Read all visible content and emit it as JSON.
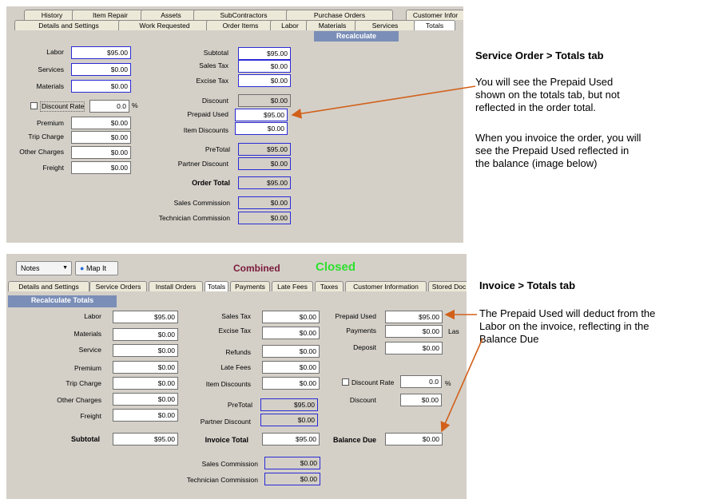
{
  "top": {
    "tabs_back": [
      "History",
      "Item Repair",
      "Assets",
      "SubContractors",
      "Purchase Orders",
      "Customer Infor"
    ],
    "tabs_front": [
      "Details and Settings",
      "Work Requested",
      "Order Items",
      "Labor",
      "Materials",
      "Services",
      "Totals"
    ],
    "recalculate": "Recalculate",
    "left": {
      "labor": {
        "label": "Labor",
        "value": "$95.00"
      },
      "services": {
        "label": "Services",
        "value": "$0.00"
      },
      "materials": {
        "label": "Materials",
        "value": "$0.00"
      },
      "discount_rate": {
        "label": "Discount Rate",
        "value": "0.0",
        "unit": "%"
      },
      "premium": {
        "label": "Premium",
        "value": "$0.00"
      },
      "trip_charge": {
        "label": "Trip Charge",
        "value": "$0.00"
      },
      "other_charges": {
        "label": "Other Charges",
        "value": "$0.00"
      },
      "freight": {
        "label": "Freight",
        "value": "$0.00"
      }
    },
    "right": {
      "subtotal": {
        "label": "Subtotal",
        "value": "$95.00"
      },
      "sales_tax": {
        "label": "Sales Tax",
        "value": "$0.00"
      },
      "excise_tax": {
        "label": "Excise Tax",
        "value": "$0.00"
      },
      "discount": {
        "label": "Discount",
        "value": "$0.00"
      },
      "prepaid_used": {
        "label": "Prepaid Used",
        "value": "$95.00"
      },
      "item_discounts": {
        "label": "Item Discounts",
        "value": "$0.00"
      },
      "pretotal": {
        "label": "PreTotal",
        "value": "$95.00"
      },
      "partner_discount": {
        "label": "Partner Discount",
        "value": "$0.00"
      },
      "order_total": {
        "label": "Order Total",
        "value": "$95.00"
      },
      "sales_commission": {
        "label": "Sales Commission",
        "value": "$0.00"
      },
      "technician_commission": {
        "label": "Technician Commission",
        "value": "$0.00"
      }
    }
  },
  "bottom": {
    "notes_button": "Notes",
    "map_button": "Map It",
    "status_combined": "Combined",
    "status_closed": "Closed",
    "tabs": [
      "Details and Settings",
      "Service Orders",
      "Install Orders",
      "Totals",
      "Payments",
      "Late Fees",
      "Taxes",
      "Customer Information",
      "Stored Doc"
    ],
    "recalculate": "Recalculate Totals",
    "col1": {
      "labor": {
        "label": "Labor",
        "value": "$95.00"
      },
      "materials": {
        "label": "Materials",
        "value": "$0.00"
      },
      "service": {
        "label": "Service",
        "value": "$0.00"
      },
      "premium": {
        "label": "Premium",
        "value": "$0.00"
      },
      "trip_charge": {
        "label": "Trip Charge",
        "value": "$0.00"
      },
      "other_charges": {
        "label": "Other Charges",
        "value": "$0.00"
      },
      "freight": {
        "label": "Freight",
        "value": "$0.00"
      },
      "subtotal": {
        "label": "Subtotal",
        "value": "$95.00"
      }
    },
    "col2": {
      "sales_tax": {
        "label": "Sales Tax",
        "value": "$0.00"
      },
      "excise_tax": {
        "label": "Excise Tax",
        "value": "$0.00"
      },
      "refunds": {
        "label": "Refunds",
        "value": "$0.00"
      },
      "late_fees": {
        "label": "Late Fees",
        "value": "$0.00"
      },
      "item_discounts": {
        "label": "Item Discounts",
        "value": "$0.00"
      },
      "pretotal": {
        "label": "PreTotal",
        "value": "$95.00"
      },
      "partner_discount": {
        "label": "Partner Discount",
        "value": "$0.00"
      },
      "invoice_total": {
        "label": "Invoice Total",
        "value": "$95.00"
      },
      "sales_commission": {
        "label": "Sales Commission",
        "value": "$0.00"
      },
      "technician_commission": {
        "label": "Technician Commission",
        "value": "$0.00"
      }
    },
    "col3": {
      "prepaid_used": {
        "label": "Prepaid Used",
        "value": "$95.00"
      },
      "payments": {
        "label": "Payments",
        "value": "$0.00"
      },
      "deposit": {
        "label": "Deposit",
        "value": "$0.00"
      },
      "discount_rate": {
        "label": "Discount Rate",
        "value": "0.0",
        "unit": "%"
      },
      "discount": {
        "label": "Discount",
        "value": "$0.00"
      },
      "balance_due": {
        "label": "Balance Due",
        "value": "$0.00"
      },
      "clipped_label": "Las"
    }
  },
  "notes": {
    "top_title": "Service Order > Totals tab",
    "top_p1": [
      "You will see the Prepaid Used",
      "shown on the totals tab, but not",
      "reflected in the order total."
    ],
    "top_p2": [
      "When you invoice the order, you will",
      "see the Prepaid Used reflected in",
      "the balance (image below)"
    ],
    "bottom_title": "Invoice > Totals tab",
    "bottom_p1": [
      "The Prepaid Used will deduct from the",
      "Labor on the invoice, reflecting in the",
      "Balance Due"
    ]
  },
  "colors": {
    "arrow": "#d2601a",
    "combined": "#7a1a3a",
    "closed": "#2ee02e",
    "field_border_blue": "#2a2ad6"
  }
}
